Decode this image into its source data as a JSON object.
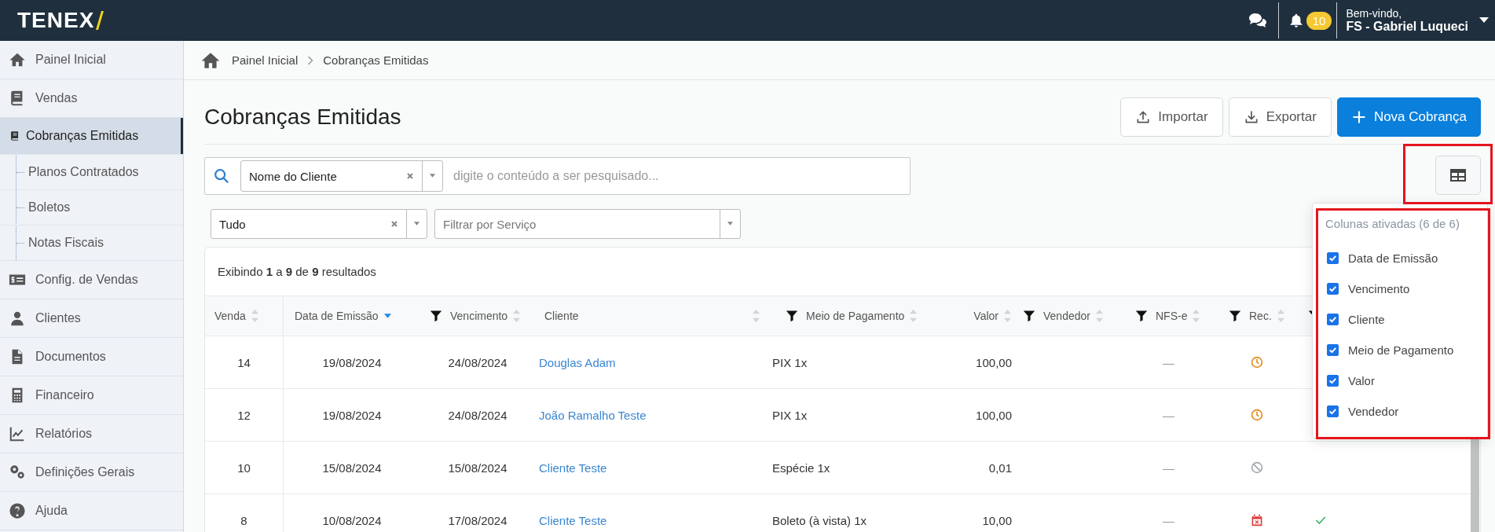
{
  "header": {
    "logo": "TENEX",
    "notifications": "10",
    "greeting": "Bem-vindo,",
    "user": "FS - Gabriel Luqueci"
  },
  "sidebar": {
    "items": [
      {
        "label": "Painel Inicial",
        "selected": false
      },
      {
        "label": "Vendas",
        "selected": false,
        "expanded": true,
        "children": [
          {
            "label": "Cobranças Emitidas",
            "selected": true
          },
          {
            "label": "Planos Contratados",
            "selected": false
          },
          {
            "label": "Boletos",
            "selected": false
          },
          {
            "label": "Notas Fiscais",
            "selected": false
          }
        ]
      },
      {
        "label": "Config. de Vendas",
        "selected": false
      },
      {
        "label": "Clientes",
        "selected": false
      },
      {
        "label": "Documentos",
        "selected": false
      },
      {
        "label": "Financeiro",
        "selected": false
      },
      {
        "label": "Relatórios",
        "selected": false
      },
      {
        "label": "Definições Gerais",
        "selected": false
      },
      {
        "label": "Ajuda",
        "selected": false
      }
    ]
  },
  "breadcrumb": [
    "Painel Inicial",
    "Cobranças Emitidas"
  ],
  "page": {
    "title": "Cobranças Emitidas",
    "buttons": [
      {
        "label": "Importar",
        "kind": "upload"
      },
      {
        "label": "Exportar",
        "kind": "download"
      },
      {
        "label": "Nova Cobrança",
        "kind": "primary"
      }
    ]
  },
  "search": {
    "field_select": "Nome do Cliente",
    "placeholder": "digite o conteúdo a ser pesquisado..."
  },
  "filters": [
    {
      "value": "Tudo"
    },
    {
      "placeholder": "Filtrar por Serviço"
    }
  ],
  "table": {
    "summary": "Exibindo **1** a **9** de **9** resultados",
    "columns": [
      {
        "label": "Venda",
        "filter": false,
        "sorted": false
      },
      {
        "label": "Data de Emissão",
        "filter": false,
        "sorted": true
      },
      {
        "label": "Vencimento",
        "filter": true,
        "sorted": false
      },
      {
        "label": "Cliente",
        "filter": false,
        "sorted": false
      },
      {
        "label": "Meio de Pagamento",
        "filter": true,
        "sorted": false
      },
      {
        "label": "Valor",
        "filter": false,
        "sorted": false
      },
      {
        "label": "Vendedor",
        "filter": true,
        "sorted": false
      },
      {
        "label": "NFS-e",
        "filter": true,
        "sorted": false
      },
      {
        "label": "Rec.",
        "filter": true,
        "sorted": false
      },
      {
        "filter": true
      }
    ],
    "rows": [
      {
        "venda": "14",
        "emissao": "19/08/2024",
        "vencimento": "24/08/2024",
        "cliente": "Douglas Adam",
        "pagamento": "PIX 1x",
        "valor": "100,00",
        "nfse": "—",
        "rec": {
          "kind": "pending"
        }
      },
      {
        "venda": "12",
        "emissao": "19/08/2024",
        "vencimento": "24/08/2024",
        "cliente": "João Ramalho Teste",
        "pagamento": "PIX 1x",
        "valor": "100,00",
        "nfse": "—",
        "rec": {
          "kind": "pending"
        }
      },
      {
        "venda": "10",
        "emissao": "15/08/2024",
        "vencimento": "15/08/2024",
        "cliente": "Cliente Teste",
        "pagamento": "Espécie 1x",
        "valor": "0,01",
        "nfse": "—",
        "rec": {
          "kind": "canceled"
        },
        "column_9_checked": false
      },
      {
        "venda": "8",
        "emissao": "10/08/2024",
        "vencimento": "17/08/2024",
        "cliente": "Cliente Teste",
        "pagamento": "Boleto (à vista) 1x",
        "valor": "10,00",
        "nfse": "—",
        "rec": {
          "kind": "overdue"
        },
        "column_9_checked": true
      }
    ]
  },
  "columns_menu": {
    "title": "Colunas ativadas (6 de 6)",
    "items": [
      {
        "label": "Data de Emissão",
        "checked": true
      },
      {
        "label": "Vencimento",
        "checked": true
      },
      {
        "label": "Cliente",
        "checked": true
      },
      {
        "label": "Meio de Pagamento",
        "checked": true
      },
      {
        "label": "Valor",
        "checked": true
      },
      {
        "label": "Vendedor",
        "checked": true
      }
    ]
  }
}
